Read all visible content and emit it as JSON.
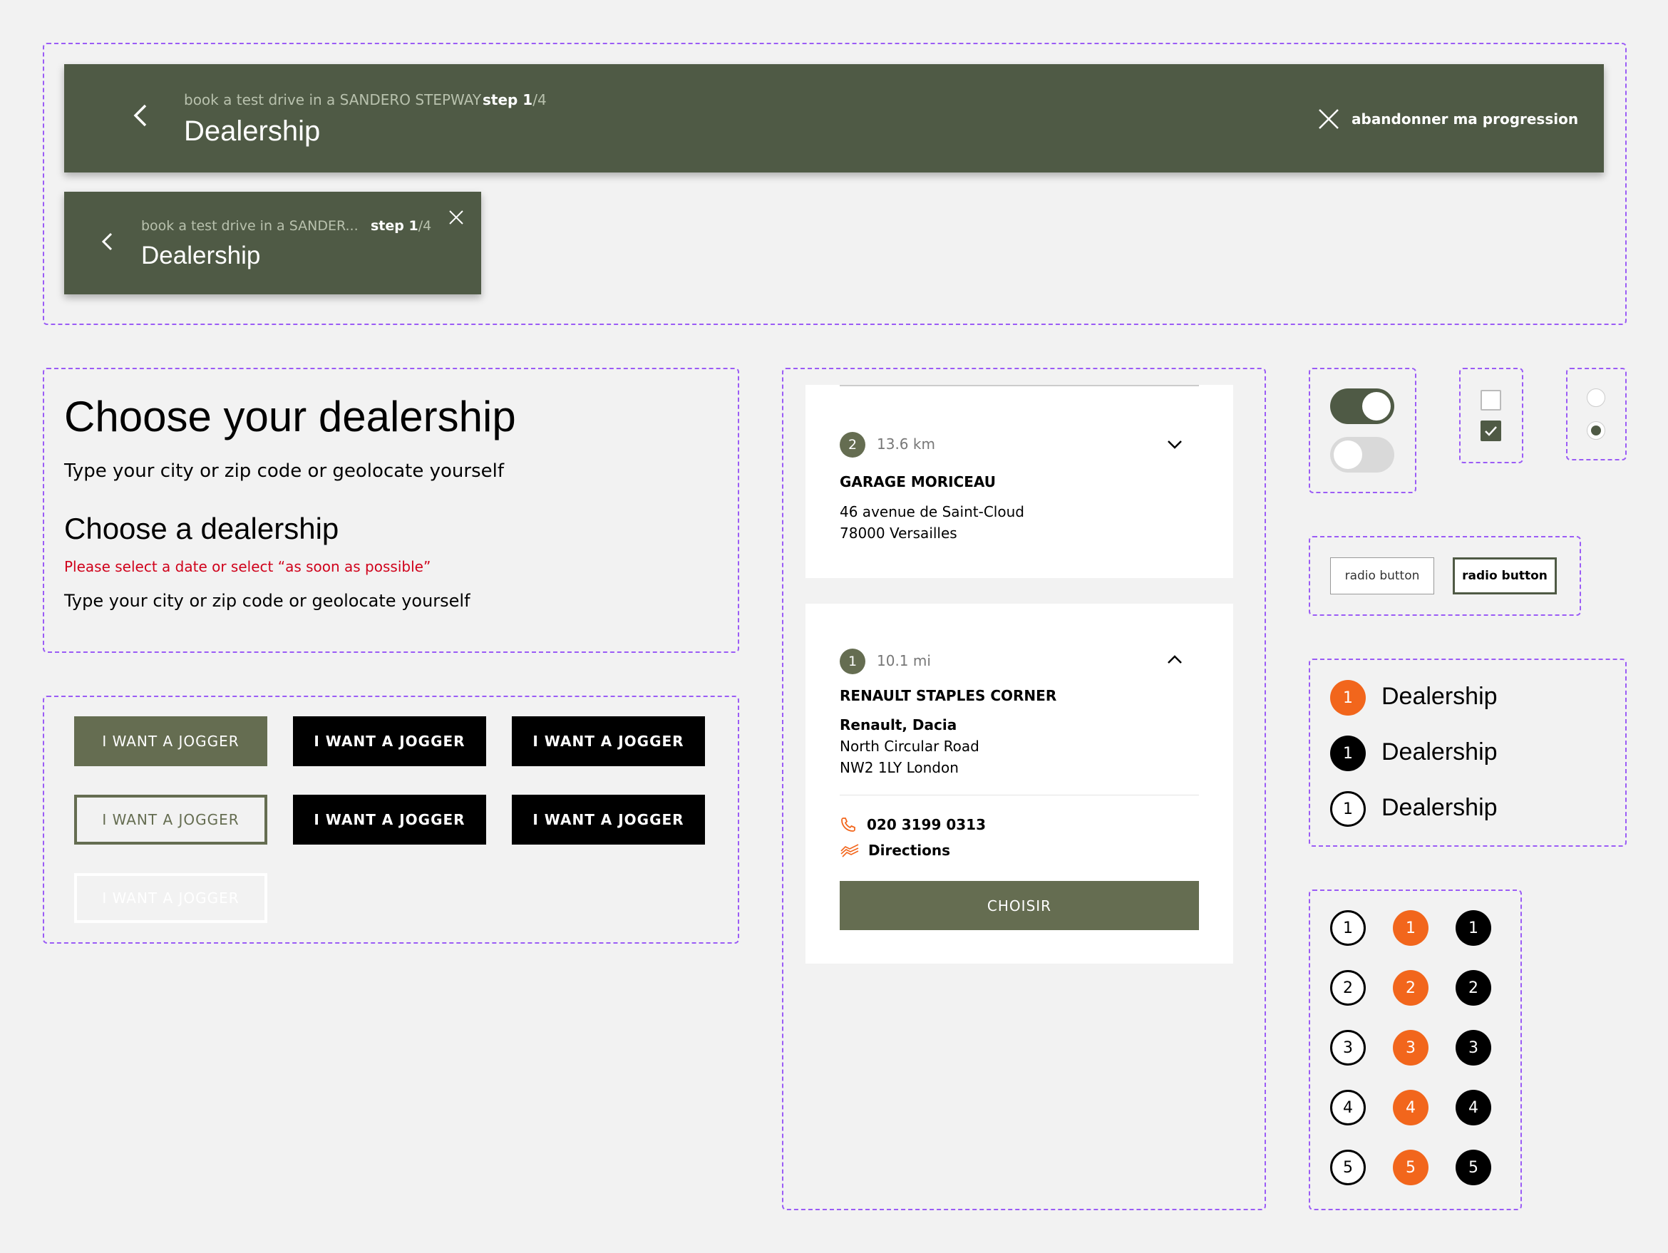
{
  "colors": {
    "olive": "#4f5a45",
    "olive_button": "#656d51",
    "orange": "#f2661c",
    "error_red": "#d0021b",
    "frame": "#9b5cf6"
  },
  "header_large": {
    "crumb": "book a test drive in a SANDERO STEPWAY",
    "step_prefix": "step 1",
    "step_total": "/4",
    "title": "Dealership",
    "abandon_label": "abandonner ma progression",
    "back_icon": "chevron-left-icon",
    "close_icon": "close-icon"
  },
  "header_small": {
    "crumb": "book a test drive in a SANDER...",
    "step_prefix": "step 1",
    "step_total": "/4",
    "title": "Dealership",
    "back_icon": "chevron-left-icon",
    "close_icon": "close-icon"
  },
  "typography": {
    "h1": "Choose your dealership",
    "body1": "Type your city or zip code or geolocate yourself",
    "h2": "Choose a dealership",
    "error": "Please select a date or select “as soon as possible”",
    "body2": "Type your city or zip code or geolocate yourself"
  },
  "buttons": {
    "labels": [
      "I WANT A JOGGER",
      "I WANT A JOGGER",
      "I WANT A JOGGER",
      "I WANT A JOGGER",
      "I WANT A JOGGER",
      "I WANT A JOGGER",
      "I WANT A JOGGER"
    ]
  },
  "card_collapsed": {
    "index": "2",
    "distance": "13.6 km",
    "name": "GARAGE MORICEAU",
    "address_line1": "46 avenue de Saint-Cloud",
    "address_line2": "78000 Versailles",
    "toggle_icon": "chevron-down-icon"
  },
  "card_expanded": {
    "index": "1",
    "distance": "10.1 mi",
    "name": "RENAULT STAPLES CORNER",
    "brands": "Renault, Dacia",
    "address_line1": "North Circular Road",
    "address_line2": "NW2 1LY London",
    "phone": "020 3199 0313",
    "directions": "Directions",
    "choose_label": "CHOISIR",
    "toggle_icon": "chevron-up-icon",
    "phone_icon": "phone-icon",
    "directions_icon": "directions-icon"
  },
  "toggles": [
    {
      "state": "on"
    },
    {
      "state": "off"
    }
  ],
  "checkboxes": [
    {
      "checked": false
    },
    {
      "checked": true
    }
  ],
  "radios": [
    {
      "selected": false
    },
    {
      "selected": true
    }
  ],
  "radio_buttons": [
    {
      "label": "radio button",
      "selected": false
    },
    {
      "label": "radio button",
      "selected": true
    }
  ],
  "steps": [
    {
      "number": "1",
      "label": "Dealership",
      "style": "orange"
    },
    {
      "number": "1",
      "label": "Dealership",
      "style": "black"
    },
    {
      "number": "1",
      "label": "Dealership",
      "style": "outline"
    }
  ],
  "number_grid": {
    "outline": [
      "1",
      "2",
      "3",
      "4",
      "5"
    ],
    "orange": [
      "1",
      "2",
      "3",
      "4",
      "5"
    ],
    "black": [
      "1",
      "2",
      "3",
      "4",
      "5"
    ]
  }
}
